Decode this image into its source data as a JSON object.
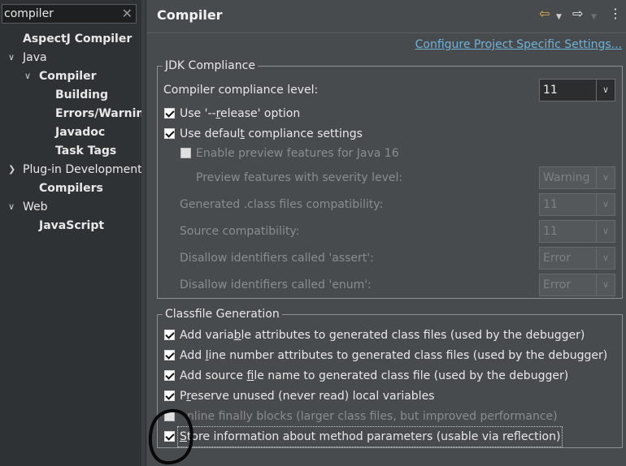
{
  "filter": {
    "value": "compiler",
    "clear_icon": "✕"
  },
  "tree": [
    {
      "label": "AspectJ Compiler",
      "bold": true,
      "arrow": ""
    },
    {
      "label": "Java",
      "bold": false,
      "arrow": "v"
    },
    {
      "label": "Compiler",
      "bold": true,
      "arrow": "v"
    },
    {
      "label": "Building",
      "bold": true,
      "arrow": ""
    },
    {
      "label": "Errors/Warnings",
      "bold": true,
      "arrow": ""
    },
    {
      "label": "Javadoc",
      "bold": true,
      "arrow": ""
    },
    {
      "label": "Task Tags",
      "bold": true,
      "arrow": ""
    },
    {
      "label": "Plug-in Development",
      "bold": false,
      "arrow": ">"
    },
    {
      "label": "Compilers",
      "bold": true,
      "arrow": ""
    },
    {
      "label": "Web",
      "bold": false,
      "arrow": "v"
    },
    {
      "label": "JavaScript",
      "bold": true,
      "arrow": ""
    }
  ],
  "page": {
    "title": "Compiler",
    "configure_link": "Configure Project Specific Settings..."
  },
  "jdk": {
    "title": "JDK Compliance",
    "compliance_label": "Compiler compliance level:",
    "compliance_value": "11",
    "use_release": {
      "pre": "Use '--",
      "u": "r",
      "post": "elease' option",
      "checked": true
    },
    "use_default": {
      "pre": "Use defaul",
      "u": "t",
      "post": " compliance settings",
      "checked": true
    },
    "enable_preview": {
      "label": "Enable preview features for Java 16",
      "checked": false
    },
    "preview_severity": {
      "label": "Preview features with severity level:",
      "value": "Warning"
    },
    "generated_compat": {
      "label": "Generated .class files compatibility:",
      "value": "11"
    },
    "source_compat": {
      "label": "Source compatibility:",
      "value": "11"
    },
    "assert_disallow": {
      "label": "Disallow identifiers called 'assert':",
      "value": "Error"
    },
    "enum_disallow": {
      "label": "Disallow identifiers called 'enum':",
      "value": "Error"
    }
  },
  "classfile": {
    "title": "Classfile Generation",
    "variable_attrs": {
      "pre": "Add varia",
      "u": "b",
      "post": "le attributes to generated class files (used by the debugger)",
      "checked": true
    },
    "line_number": {
      "pre": "Add ",
      "u": "l",
      "post": "ine number attributes to generated class files (used by the debugger)",
      "checked": true
    },
    "source_file": {
      "pre": "Add source ",
      "u": "f",
      "post": "ile name to generated class file (used by the debugger)",
      "checked": true
    },
    "preserve_vars": {
      "pre": "P",
      "u": "r",
      "post": "eserve unused (never read) local variables",
      "checked": true
    },
    "inline_finally": {
      "label": "nline finally blocks (larger class files, but improved performance)",
      "checked": false
    },
    "store_params": {
      "pre": "",
      "u": "S",
      "post": "tore information about method parameters (usable via reflection)",
      "checked": true
    }
  },
  "icons": {
    "back": "back-arrow-icon",
    "forward": "forward-arrow-icon",
    "menu": "view-menu-icon"
  },
  "colors": {
    "back_arrow": "#e8b34a",
    "link": "#6fb3d8"
  }
}
